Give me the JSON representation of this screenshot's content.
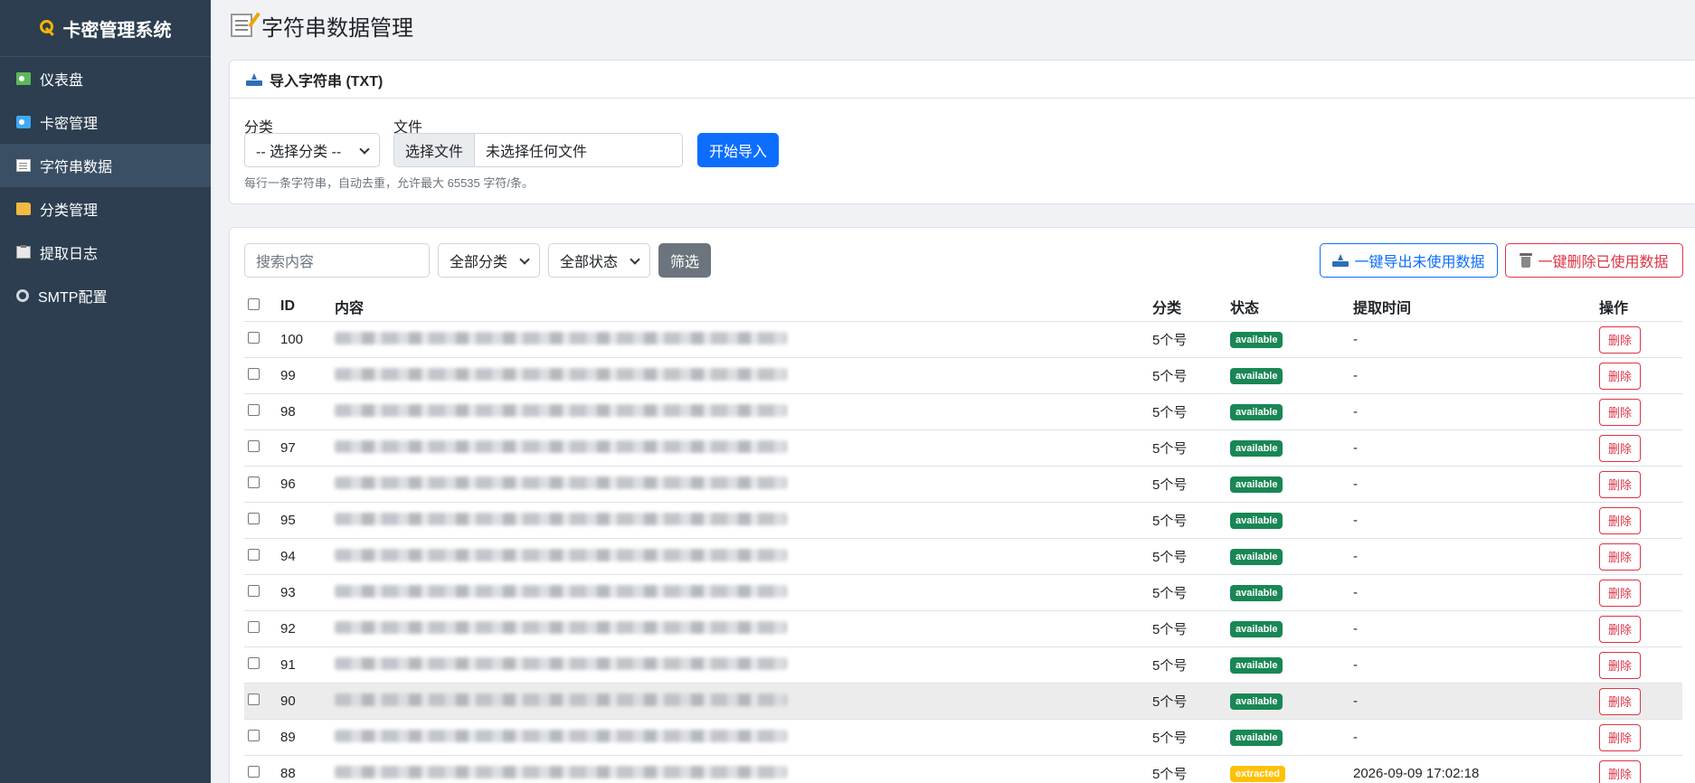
{
  "app": {
    "title": "卡密管理系统"
  },
  "sidebar": {
    "items": [
      {
        "label": "仪表盘",
        "icon": "chart-icon"
      },
      {
        "label": "卡密管理",
        "icon": "card-icon"
      },
      {
        "label": "字符串数据",
        "icon": "memo-icon",
        "active": true
      },
      {
        "label": "分类管理",
        "icon": "folder-icon"
      },
      {
        "label": "提取日志",
        "icon": "clipboard-icon"
      },
      {
        "label": "SMTP配置",
        "icon": "gear-icon"
      }
    ]
  },
  "page": {
    "title": "字符串数据管理"
  },
  "import": {
    "header": "导入字符串 (TXT)",
    "category_label": "分类",
    "category_value": "-- 选择分类 --",
    "file_label": "文件",
    "file_button": "选择文件",
    "file_name": "未选择任何文件",
    "submit": "开始导入",
    "hint": "每行一条字符串，自动去重，允许最大 65535 字符/条。"
  },
  "filters": {
    "search_placeholder": "搜索内容",
    "category": "全部分类",
    "status": "全部状态",
    "submit": "筛选",
    "export": "一键导出未使用数据",
    "delete_used": "一键删除已使用数据"
  },
  "table": {
    "headers": {
      "id": "ID",
      "content": "内容",
      "category": "分类",
      "status": "状态",
      "time": "提取时间",
      "op": "操作"
    },
    "delete_label": "删除",
    "rows": [
      {
        "id": "100",
        "category": "5个号",
        "status": "available",
        "time": "-"
      },
      {
        "id": "99",
        "category": "5个号",
        "status": "available",
        "time": "-"
      },
      {
        "id": "98",
        "category": "5个号",
        "status": "available",
        "time": "-"
      },
      {
        "id": "97",
        "category": "5个号",
        "status": "available",
        "time": "-"
      },
      {
        "id": "96",
        "category": "5个号",
        "status": "available",
        "time": "-"
      },
      {
        "id": "95",
        "category": "5个号",
        "status": "available",
        "time": "-"
      },
      {
        "id": "94",
        "category": "5个号",
        "status": "available",
        "time": "-"
      },
      {
        "id": "93",
        "category": "5个号",
        "status": "available",
        "time": "-"
      },
      {
        "id": "92",
        "category": "5个号",
        "status": "available",
        "time": "-"
      },
      {
        "id": "91",
        "category": "5个号",
        "status": "available",
        "time": "-"
      },
      {
        "id": "90",
        "category": "5个号",
        "status": "available",
        "time": "-"
      },
      {
        "id": "89",
        "category": "5个号",
        "status": "available",
        "time": "-"
      },
      {
        "id": "88",
        "category": "5个号",
        "status": "extracted",
        "time": "2026-09-09 17:02:18"
      }
    ]
  }
}
